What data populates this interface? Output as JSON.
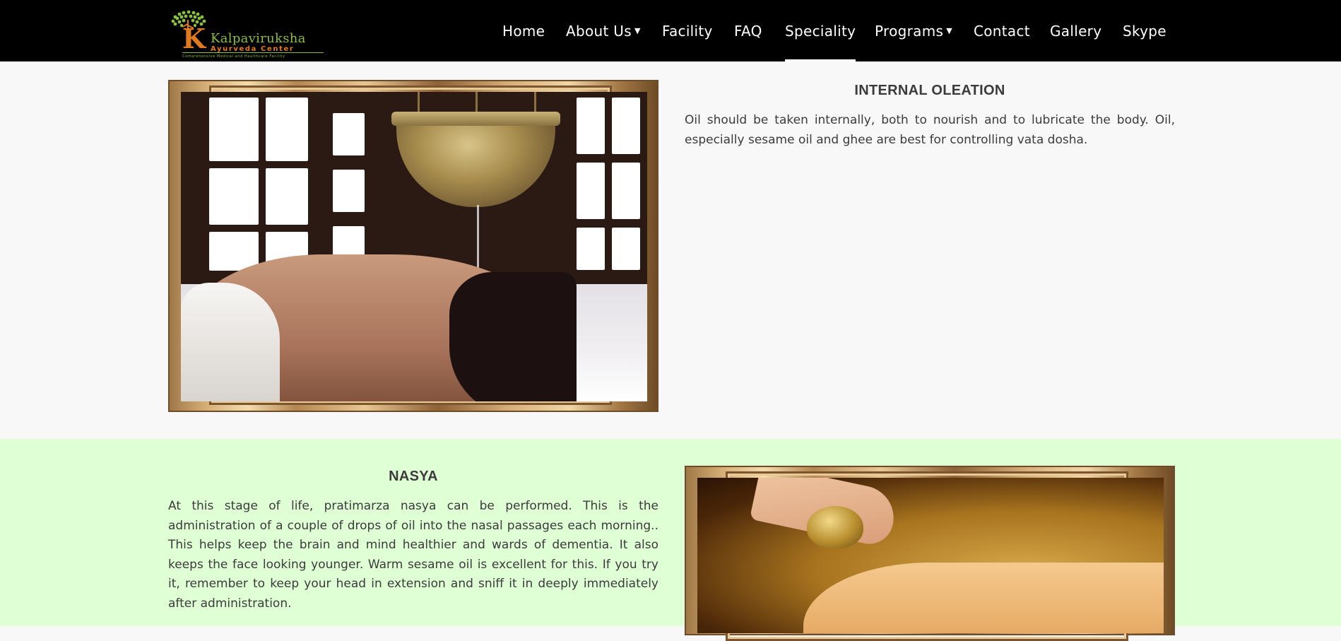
{
  "brand": {
    "name": "Kalpaviruksha",
    "subtitle": "Ayurveda Center",
    "tagline": "Comprehensive Medical and Healthcare Facility",
    "accent_green": "#8cbf3f",
    "accent_orange": "#e07a1f"
  },
  "nav": {
    "items": [
      {
        "label": "Home",
        "dropdown": false
      },
      {
        "label": "About Us",
        "dropdown": true
      },
      {
        "label": "Facility",
        "dropdown": false
      },
      {
        "label": "FAQ",
        "dropdown": false
      },
      {
        "label": "Speciality",
        "dropdown": false,
        "active": true
      },
      {
        "label": "Programs",
        "dropdown": true
      },
      {
        "label": "Contact",
        "dropdown": false
      },
      {
        "label": "Gallery",
        "dropdown": false
      },
      {
        "label": "Skype",
        "dropdown": false
      }
    ],
    "caret_icon": "caret-down-icon"
  },
  "sections": [
    {
      "heading": "INTERNAL OLEATION",
      "body": "Oil should be taken internally, both to nourish and to lubricate the body. Oil, especially sesame oil and ghee are best for controlling vata dosha.",
      "background": "#f8f8f8"
    },
    {
      "heading": "NASYA",
      "body": "At this stage of life, pratimarza nasya can be performed. This is the administration of a couple of drops of oil into the nasal passages each morning.. This helps keep the brain and mind healthier and wards of dementia. It also keeps the face looking younger. Warm sesame oil is excellent for this. If you try it, remember to keep your head in extension and sniff it in deeply immediately after administration.",
      "background": "#dfffd5"
    }
  ]
}
